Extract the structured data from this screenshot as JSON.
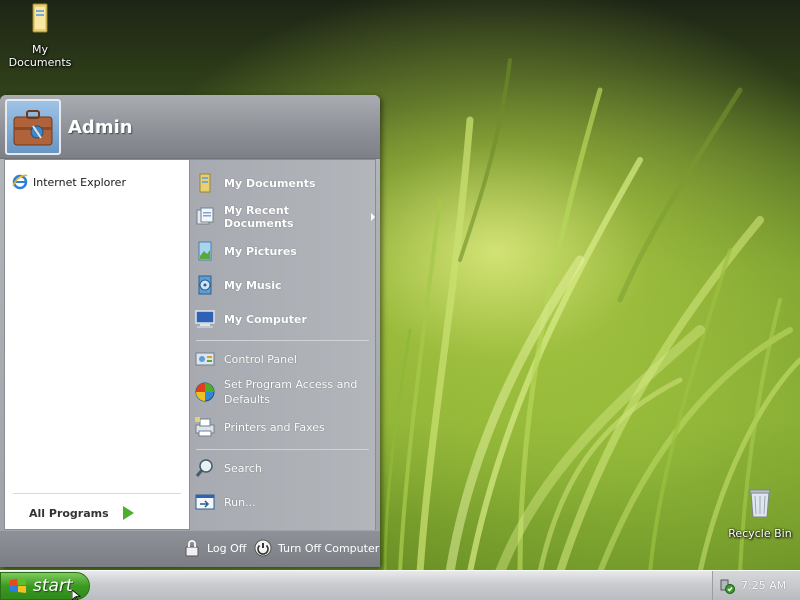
{
  "desktop": {
    "icons": [
      {
        "label": "My Documents",
        "icon": "folder-documents-icon"
      },
      {
        "label": "Recycle Bin",
        "icon": "recycle-bin-icon"
      }
    ]
  },
  "start_menu": {
    "user_name": "Admin",
    "pinned": [
      {
        "label": "Internet Explorer",
        "icon": "internet-explorer-icon"
      }
    ],
    "all_programs_label": "All Programs",
    "right_items": [
      {
        "label": "My Documents",
        "icon": "my-documents-icon",
        "bold": true
      },
      {
        "label": "My Recent Documents",
        "icon": "recent-documents-icon",
        "bold": true,
        "submenu": true
      },
      {
        "label": "My Pictures",
        "icon": "my-pictures-icon",
        "bold": true
      },
      {
        "label": "My Music",
        "icon": "my-music-icon",
        "bold": true
      },
      {
        "label": "My Computer",
        "icon": "my-computer-icon",
        "bold": true
      },
      {
        "label": "Control Panel",
        "icon": "control-panel-icon",
        "bold": false
      },
      {
        "label": "Set Program Access and Defaults",
        "icon": "program-access-icon",
        "bold": false
      },
      {
        "label": "Printers and Faxes",
        "icon": "printer-icon",
        "bold": false
      },
      {
        "label": "Search",
        "icon": "search-icon",
        "bold": false
      },
      {
        "label": "Run...",
        "icon": "run-icon",
        "bold": false
      }
    ],
    "footer": {
      "log_off_label": "Log Off",
      "turn_off_label": "Turn Off Computer"
    }
  },
  "taskbar": {
    "start_label": "start",
    "clock": "7:25 AM"
  },
  "colors": {
    "start_green": "#3c9a22",
    "menu_gray": "#9ea2a8",
    "all_programs_arrow": "#4caf2a"
  }
}
